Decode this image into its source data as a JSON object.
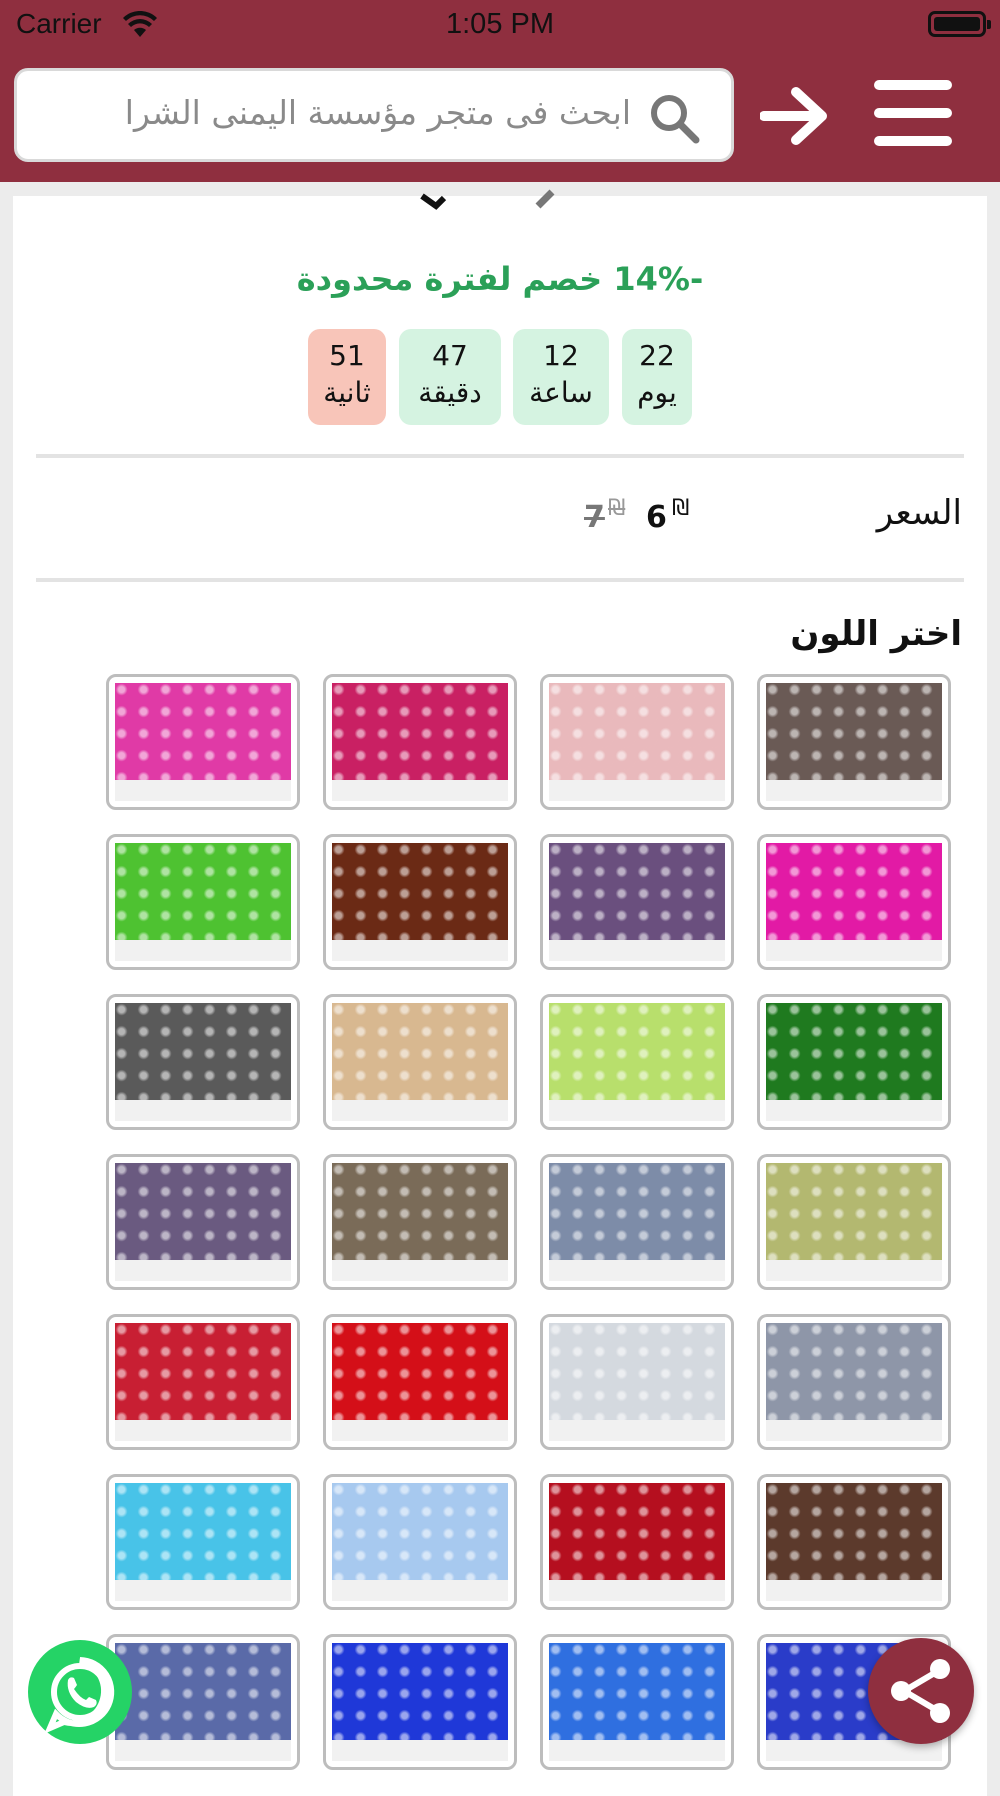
{
  "status_bar": {
    "carrier": "Carrier",
    "time": "1:05 PM"
  },
  "header": {
    "search_placeholder": "ابحث فى متجر مؤسسة اليمنى الشرا",
    "icons": [
      "search-icon",
      "back-arrow-icon",
      "menu-icon"
    ],
    "background": "#8f2f3f"
  },
  "offer": {
    "discount_text": "-14% خصم لفترة محدودة",
    "discount_color": "#2ba058"
  },
  "countdown": {
    "days": {
      "value": "22",
      "label": "يوم"
    },
    "hours": {
      "value": "12",
      "label": "ساعة"
    },
    "minutes": {
      "value": "47",
      "label": "دقيقة"
    },
    "seconds": {
      "value": "51",
      "label": "ثانية"
    }
  },
  "price": {
    "label": "السعر",
    "current": "6",
    "current_currency": "₪",
    "original": "7",
    "original_currency": "₪"
  },
  "colors": {
    "title": "اختر اللون",
    "swatches": [
      "#6a5a55",
      "#e9b9bc",
      "#c92063",
      "#e03aa6",
      "#e21aa5",
      "#6a4f7e",
      "#6b2a15",
      "#4ec231",
      "#1f7a1f",
      "#b8df6c",
      "#d8b890",
      "#5a5a5a",
      "#b3b870",
      "#7d8ca8",
      "#7a6b58",
      "#6a5a80",
      "#8e96a8",
      "#d4d9df",
      "#d40f18",
      "#c81f33",
      "#5c3a2c",
      "#b50f1f",
      "#a7c9ef",
      "#48c3e8",
      "#2a3cc9",
      "#2f6fe0",
      "#1f38d8",
      "#5a6aa8"
    ]
  },
  "floating": {
    "whatsapp": "whatsapp-icon",
    "share": "share-icon"
  }
}
